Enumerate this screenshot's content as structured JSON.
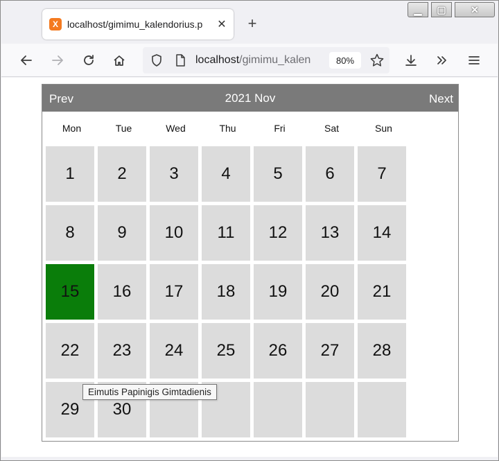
{
  "browser": {
    "tab_title": "localhost/gimimu_kalendorius.p",
    "tab_favicon_glyph": "X",
    "url_host": "localhost",
    "url_path": "/gimimu_kalen",
    "zoom": "80%"
  },
  "calendar": {
    "prev_label": "Prev",
    "title": "2021 Nov",
    "next_label": "Next",
    "weekdays": [
      "Mon",
      "Tue",
      "Wed",
      "Thu",
      "Fri",
      "Sat",
      "Sun"
    ],
    "weeks": [
      [
        "1",
        "2",
        "3",
        "4",
        "5",
        "6",
        "7"
      ],
      [
        "8",
        "9",
        "10",
        "11",
        "12",
        "13",
        "14"
      ],
      [
        "15",
        "16",
        "17",
        "18",
        "19",
        "20",
        "21"
      ],
      [
        "22",
        "23",
        "24",
        "25",
        "26",
        "27",
        "28"
      ],
      [
        "29",
        "30",
        "",
        "",
        "",
        "",
        ""
      ]
    ],
    "event_day": "15",
    "event_color": "#0a7d0a",
    "cell_color": "#dcdcdc",
    "header_color": "#7a7a7a"
  },
  "tooltip": {
    "text": "Eimutis Papinigis Gimtadienis"
  }
}
